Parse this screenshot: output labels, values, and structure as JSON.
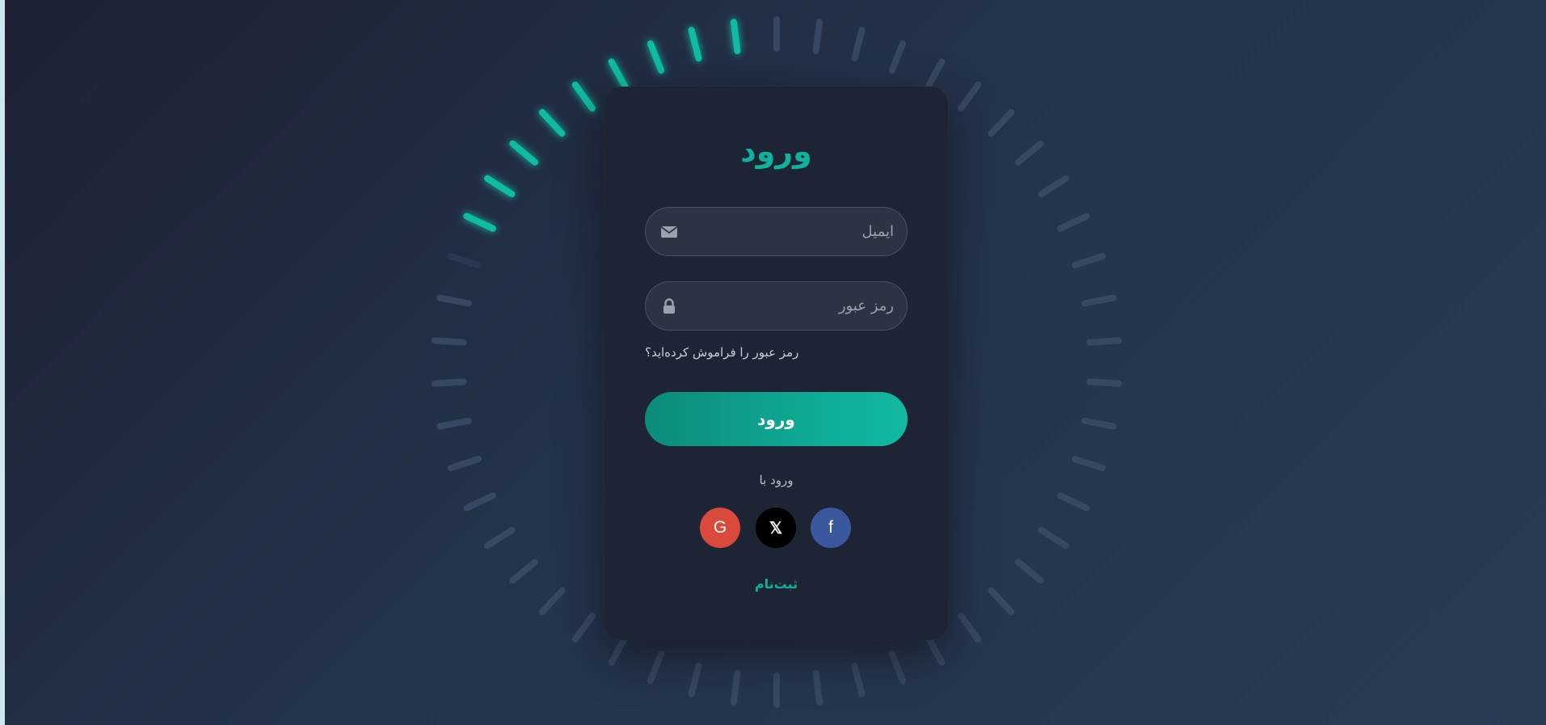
{
  "login_card": {
    "title": "ورود",
    "email_field": {
      "placeholder": "ایمیل",
      "value": ""
    },
    "password_field": {
      "placeholder": "رمز عبور",
      "value": ""
    },
    "forgot_password_label": "رمز عبور را فراموش کرده‌اید؟",
    "submit_label": "ورود",
    "social_login_label": "ورود با",
    "social_buttons": [
      {
        "name": "google",
        "glyph": "G",
        "color": "#d94a3c"
      },
      {
        "name": "x",
        "glyph": "𝕏",
        "color": "#000000"
      },
      {
        "name": "facebook",
        "glyph": "f",
        "color": "#3b579d"
      }
    ],
    "register_label": "ثبت‌نام"
  },
  "colors": {
    "accent": "#10b29b",
    "card_background": "#1d2535",
    "page_background": "#24324a",
    "ring_active": "#10c4a6",
    "ring_inactive": "#3c4c66"
  },
  "icons": {
    "email_field": "envelope-icon",
    "password_field": "lock-icon"
  }
}
